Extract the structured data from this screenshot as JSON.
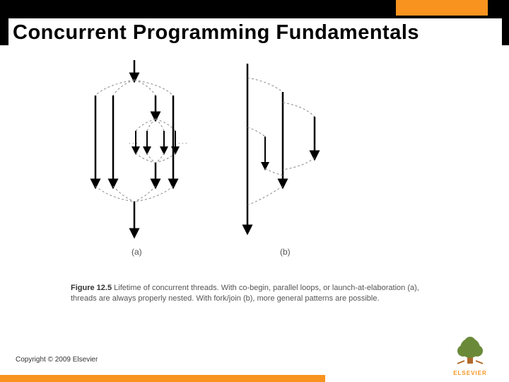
{
  "title": "Concurrent Programming Fundamentals",
  "figure": {
    "label_a": "(a)",
    "label_b": "(b)",
    "ellipsis": ". . ."
  },
  "caption": {
    "prefix": "Figure 12.5",
    "bold": "Lifetime of concurrent threads.",
    "rest": "With co-begin, parallel loops, or launch-at-elaboration (a), threads are always properly nested. With fork/join (b), more general patterns are possible."
  },
  "copyright": "Copyright © 2009 Elsevier",
  "logo_text": "ELSEVIER"
}
